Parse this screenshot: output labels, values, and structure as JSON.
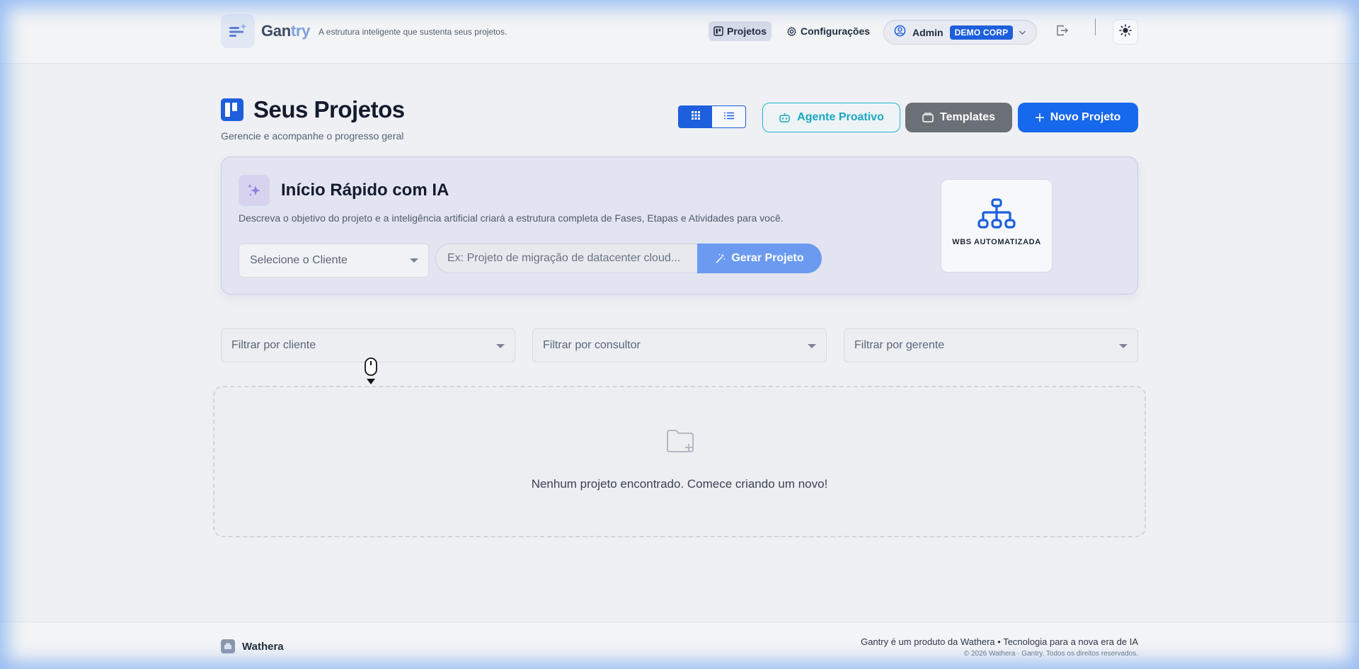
{
  "header": {
    "brand_part1": "Gan",
    "brand_part2": "try",
    "tagline": "A estrutura inteligente que sustenta seus projetos.",
    "nav": {
      "projects": "Projetos",
      "settings": "Configurações"
    },
    "user": {
      "name": "Admin",
      "company": "DEMO CORP"
    }
  },
  "page": {
    "title": "Seus Projetos",
    "subtitle": "Gerencie e acompanhe o progresso geral",
    "view_mode": "grid",
    "buttons": {
      "agent": "Agente Proativo",
      "templates": "Templates",
      "new_project": "Novo Projeto"
    }
  },
  "ai_quickstart": {
    "title": "Início Rápido com IA",
    "description": "Descreva o objetivo do projeto e a inteligência artificial criará a estrutura completa de Fases, Etapas e Atividades para você.",
    "client_select": "Selecione o Cliente",
    "prompt_placeholder": "Ex: Projeto de migração de datacenter cloud...",
    "generate_button": "Gerar Projeto",
    "wbs_label": "WBS AUTOMATIZADA"
  },
  "filters": {
    "client": "Filtrar por cliente",
    "consultant": "Filtrar por consultor",
    "manager": "Filtrar por gerente"
  },
  "empty_state": {
    "message": "Nenhum projeto encontrado. Comece criando um novo!"
  },
  "footer": {
    "brand": "Wathera",
    "line1": "Gantry é um produto da Wathera • Tecnologia para a nova era de IA",
    "line2": "© 2026 Wathera · Gantry. Todos os direitos reservados."
  },
  "colors": {
    "primary": "#1668ec",
    "accent_teal": "#1aa7c1",
    "templates_gray": "#6b7077",
    "ai_card_bg": "#e2e4f1"
  }
}
